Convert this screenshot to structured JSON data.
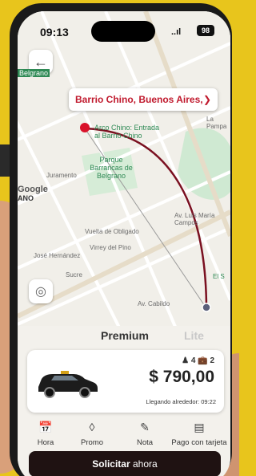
{
  "status_bar": {
    "time": "09:13",
    "battery": "98",
    "signal": "..ıl"
  },
  "map": {
    "destination": "Barrio Chino, Buenos Aires,...",
    "labels": {
      "belgrano": "Belgrano",
      "arco": "Arco Chino: Entrada al Barrio Chino",
      "parque": "Parque Barrancas de Belgrano",
      "juramento": "Juramento",
      "sucre": "Sucre",
      "vuelta": "Vuelta de Obligado",
      "virrey": "Virrey del Pino",
      "jose": "José Hernández",
      "luis": "Av. Luis María Campos",
      "cabildo": "Av. Cabildo",
      "pampa": "La Pampa",
      "google": "Google",
      "ano": "ANO",
      "el": "El S"
    }
  },
  "sheet": {
    "tabs": [
      "Premium",
      "Lite"
    ],
    "capacity_people": "4",
    "capacity_bags": "2",
    "price": "$ 790,00",
    "eta": "Llegando alrededor: 09:22",
    "actions": [
      {
        "label": "Hora",
        "icon": "calendar-icon"
      },
      {
        "label": "Promo",
        "icon": "tag-icon"
      },
      {
        "label": "Nota",
        "icon": "note-icon"
      },
      {
        "label": "Pago con tarjeta",
        "icon": "card-icon"
      }
    ],
    "request_bold": "Solicitar",
    "request_rest": " ahora"
  },
  "colors": {
    "accent": "#c0192d",
    "route": "#7a1020",
    "button": "#1f1212",
    "background": "#e8c51c"
  }
}
